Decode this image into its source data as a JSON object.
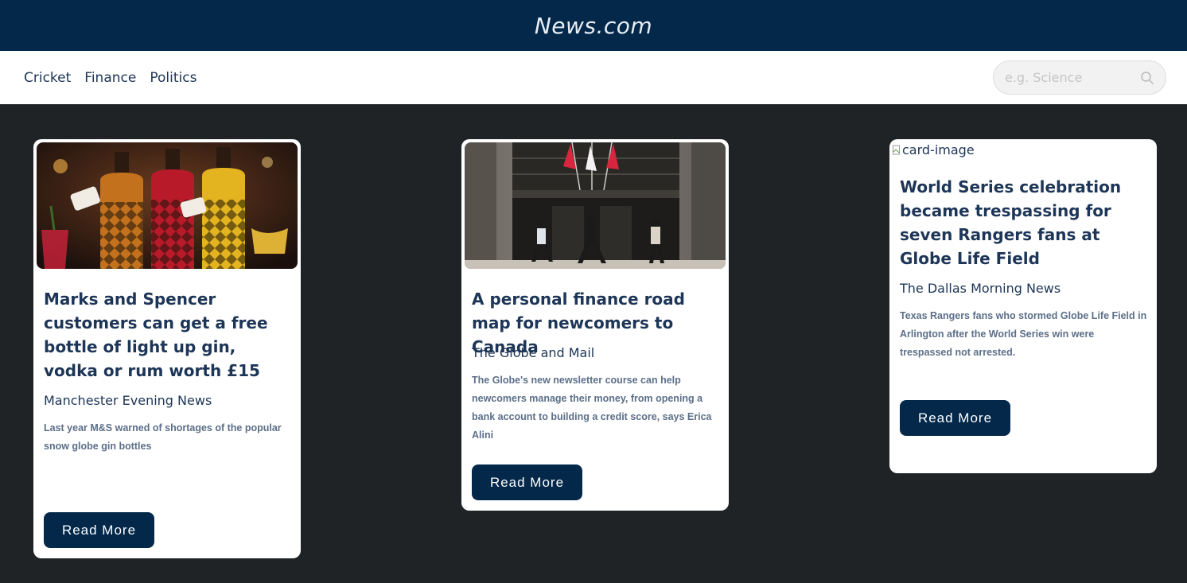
{
  "header": {
    "brand": "News.com"
  },
  "nav": {
    "items": [
      "Cricket",
      "Finance",
      "Politics"
    ]
  },
  "search": {
    "placeholder": "e.g. Science"
  },
  "cards": [
    {
      "title": "Marks and Spencer customers can get a free bottle of light up gin, vodka or rum worth £15",
      "source": "Manchester Evening News",
      "description": "Last year M&S warned of shortages of the popular snow globe gin bottles",
      "button": "Read More"
    },
    {
      "title": "A personal finance road map for newcomers to Canada",
      "source": "The Globe and Mail",
      "description": "The Globe's new newsletter course can help newcomers manage their money, from opening a bank account to building a credit score, says Erica Alini",
      "button": "Read More"
    },
    {
      "image_alt": "card-image",
      "title": "World Series celebration became trespassing for seven Rangers fans at Globe Life Field",
      "source": "The Dallas Morning News",
      "description": "Texas Rangers fans who stormed Globe Life Field in Arlington after the World Series win were trespassed not arrested.",
      "button": "Read More"
    }
  ],
  "colors": {
    "header_bg": "#03284a",
    "page_bg": "#1f2326",
    "text_navy": "#1d3557",
    "button_bg": "#03284a"
  }
}
